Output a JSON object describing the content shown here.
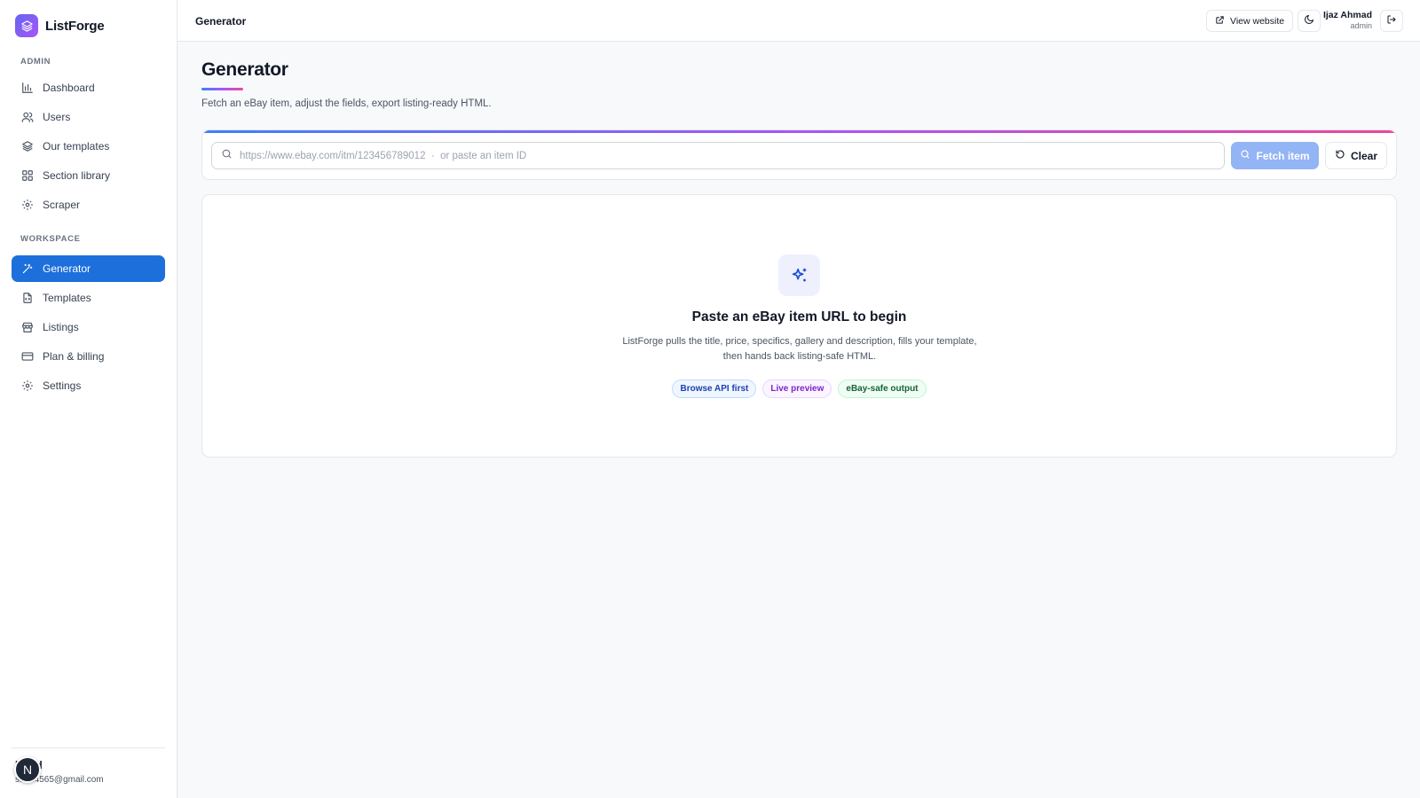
{
  "brand": {
    "name": "ListForge",
    "icon": "layers-icon",
    "accent": "#7c5cf5"
  },
  "sidebar": {
    "sections": [
      {
        "label": "ADMIN",
        "items": [
          {
            "label": "Dashboard",
            "icon": "bar-chart-icon"
          },
          {
            "label": "Users",
            "icon": "users-icon"
          },
          {
            "label": "Our templates",
            "icon": "layers-icon"
          },
          {
            "label": "Section library",
            "icon": "grid-icon"
          },
          {
            "label": "Scraper",
            "icon": "gear-icon"
          }
        ]
      },
      {
        "label": "WORKSPACE",
        "items": [
          {
            "label": "Generator",
            "icon": "magic-wand-icon",
            "active": true
          },
          {
            "label": "Templates",
            "icon": "file-code-icon"
          },
          {
            "label": "Listings",
            "icon": "store-icon"
          },
          {
            "label": "Plan & billing",
            "icon": "credit-card-icon"
          },
          {
            "label": "Settings",
            "icon": "gear-icon"
          }
        ]
      }
    ],
    "active_color": "#1d6fdc",
    "user": {
      "avatar_letter": "N",
      "name": "hmad",
      "email": "s...m4565@gmail.com"
    }
  },
  "topbar": {
    "title": "Generator",
    "view_website_label": "View website",
    "user_name": "Ijaz Ahmad",
    "user_role": "admin"
  },
  "main": {
    "title": "Generator",
    "subtitle": "Fetch an eBay item, adjust the fields, export listing-ready HTML.",
    "search": {
      "placeholder": "https://www.ebay.com/itm/123456789012  ·  or paste an item ID",
      "value": ""
    },
    "fetch_label": "Fetch item",
    "clear_label": "Clear",
    "empty_state": {
      "icon": "sparkles-icon",
      "title": "Paste an eBay item URL to begin",
      "description": "ListForge pulls the title, price, specifics, gallery and description, fills your template, then hands back listing-safe HTML.",
      "pills": [
        "Browse API first",
        "Live preview",
        "eBay-safe output"
      ]
    }
  }
}
